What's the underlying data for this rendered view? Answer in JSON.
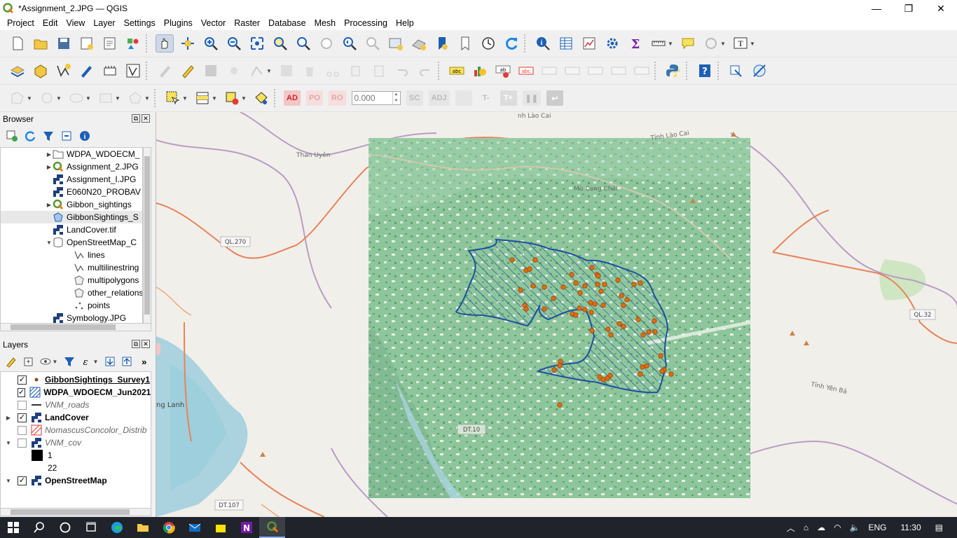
{
  "window": {
    "title": "*Assignment_2.JPG — QGIS",
    "minimize": "—",
    "maximize": "❐",
    "close": "✕"
  },
  "menu": [
    "Project",
    "Edit",
    "View",
    "Layer",
    "Settings",
    "Plugins",
    "Vector",
    "Raster",
    "Database",
    "Mesh",
    "Processing",
    "Help"
  ],
  "digitizing": {
    "ad": "AD",
    "po": "PO",
    "ro": "RO",
    "value": "0.000",
    "sc": "SC",
    "adj": "ADJ",
    "t_minus": "T-",
    "t_plus": "T+"
  },
  "browser": {
    "title": "Browser",
    "items": [
      {
        "label": "WDPA_WDOECM_",
        "icon": "folder-icon",
        "expand": "▶"
      },
      {
        "label": "Assignment_2.JPG",
        "icon": "qgis-project-icon",
        "expand": "▶"
      },
      {
        "label": "Assignment_I.JPG",
        "icon": "raster-icon",
        "expand": ""
      },
      {
        "label": "E060N20_PROBAV",
        "icon": "raster-icon",
        "expand": ""
      },
      {
        "label": "Gibbon_sightings",
        "icon": "qgis-project-icon",
        "expand": "▶"
      },
      {
        "label": "GibbonSightings_S",
        "icon": "polygon-layer-icon",
        "expand": ""
      },
      {
        "label": "LandCover.tif",
        "icon": "raster-icon",
        "expand": ""
      },
      {
        "label": "OpenStreetMap_C",
        "icon": "database-icon",
        "expand": "▼"
      },
      {
        "label": "lines",
        "icon": "line-layer-icon",
        "expand": ""
      },
      {
        "label": "multilinestring",
        "icon": "line-layer-icon",
        "expand": ""
      },
      {
        "label": "multipolygons",
        "icon": "polygon-layer-icon",
        "expand": ""
      },
      {
        "label": "other_relations",
        "icon": "polygon-layer-icon",
        "expand": ""
      },
      {
        "label": "points",
        "icon": "point-layer-icon",
        "expand": ""
      },
      {
        "label": "Symbology.JPG",
        "icon": "raster-icon",
        "expand": "▶"
      }
    ]
  },
  "layers": {
    "title": "Layers",
    "items": [
      {
        "label": "GibbonSightings_Survey1",
        "checked": "✓",
        "expand": ""
      },
      {
        "label": "WDPA_WDOECM_Jun2021_",
        "checked": "✓",
        "expand": ""
      },
      {
        "label": "VNM_roads",
        "checked": "",
        "expand": ""
      },
      {
        "label": "LandCover",
        "checked": "✓",
        "expand": "▶"
      },
      {
        "label": "NomascusConcolor_Distrib",
        "checked": "",
        "expand": ""
      },
      {
        "label": "VNM_cov",
        "checked": "",
        "expand": "▼"
      },
      {
        "label": "1",
        "checked": "",
        "expand": ""
      },
      {
        "label": "22",
        "checked": "",
        "expand": ""
      },
      {
        "label": "OpenStreetMap",
        "checked": "✓",
        "expand": "▼"
      }
    ]
  },
  "map": {
    "labels": {
      "ql270": "QL.270",
      "ql32": "QL.32",
      "dt107": "DT.107",
      "dt": "DT.10",
      "than_uyen": "Than Uyên",
      "tinh_lao_cai": "Tỉnh Lào Cai",
      "tinh_yen_bai": "Tỉnh Yên Bá",
      "mu_cang_chai": "Mù Cang Chải",
      "lao_cai": "nh Lào Cai",
      "lanh": "ng Lanh"
    },
    "colors": {
      "landcover": "#8dc69b",
      "boundary": "#1f4fa0",
      "sightings": "#e06b10",
      "roads": "#e8825c",
      "water": "#aad3df"
    }
  },
  "taskbar": {
    "lang": "ENG",
    "time": "11:30"
  }
}
